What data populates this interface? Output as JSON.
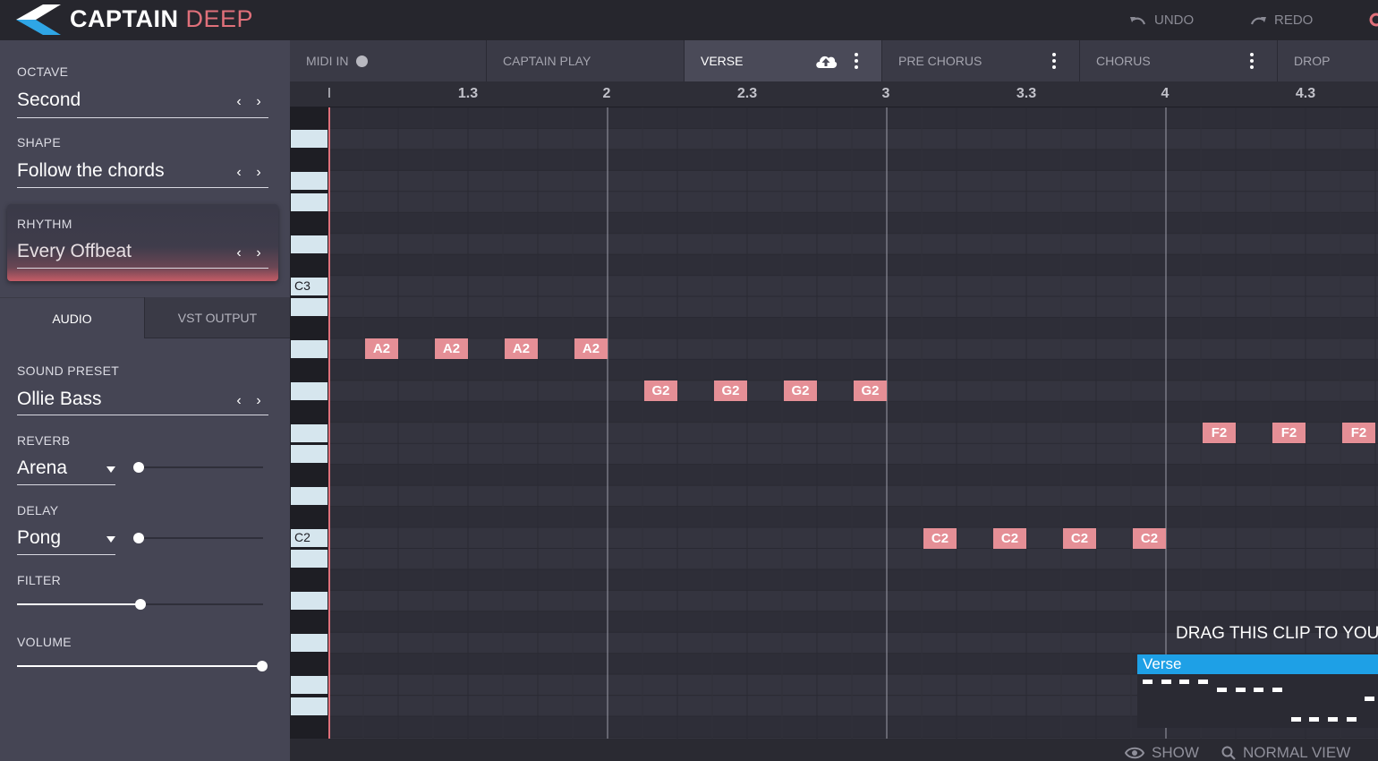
{
  "brand": {
    "first": "CAPTAIN",
    "second": "DEEP"
  },
  "topbar": {
    "undo": "UNDO",
    "redo": "REDO"
  },
  "controls": {
    "octave": {
      "label": "OCTAVE",
      "value": "Second"
    },
    "shape": {
      "label": "SHAPE",
      "value": "Follow the chords"
    },
    "rhythm": {
      "label": "RHYTHM",
      "value": "Every Offbeat"
    }
  },
  "tabs": {
    "audio": "AUDIO",
    "vst": "VST OUTPUT"
  },
  "audio": {
    "sound_preset": {
      "label": "SOUND PRESET",
      "value": "Ollie Bass"
    },
    "reverb": {
      "label": "REVERB",
      "value": "Arena",
      "amount": 0
    },
    "delay": {
      "label": "DELAY",
      "value": "Pong",
      "amount": 0
    },
    "filter": {
      "label": "FILTER",
      "amount": 0.5
    },
    "volume": {
      "label": "VOLUME",
      "amount": 1.0
    }
  },
  "sections": [
    {
      "label": "MIDI IN"
    },
    {
      "label": "CAPTAIN PLAY"
    },
    {
      "label": "VERSE",
      "active": true
    },
    {
      "label": "PRE CHORUS"
    },
    {
      "label": "CHORUS"
    },
    {
      "label": "DROP"
    }
  ],
  "ruler": {
    "start_tick": "I",
    "labels": [
      "1.3",
      "2",
      "2.3",
      "3",
      "3.3",
      "4",
      "4.3"
    ]
  },
  "piano": {
    "c3": "C3",
    "c2": "C2"
  },
  "notes": [
    {
      "pitch": "A2",
      "beat": 1
    },
    {
      "pitch": "A2",
      "beat": 2
    },
    {
      "pitch": "A2",
      "beat": 3
    },
    {
      "pitch": "A2",
      "beat": 4
    },
    {
      "pitch": "G2",
      "beat": 5
    },
    {
      "pitch": "G2",
      "beat": 6
    },
    {
      "pitch": "G2",
      "beat": 7
    },
    {
      "pitch": "G2",
      "beat": 8
    },
    {
      "pitch": "C2",
      "beat": 9
    },
    {
      "pitch": "C2",
      "beat": 10
    },
    {
      "pitch": "C2",
      "beat": 11
    },
    {
      "pitch": "C2",
      "beat": 12
    },
    {
      "pitch": "F2",
      "beat": 13
    },
    {
      "pitch": "F2",
      "beat": 14
    },
    {
      "pitch": "F2",
      "beat": 15
    }
  ],
  "drag": {
    "hint": "DRAG THIS CLIP TO YOUR",
    "clip_title": "Verse"
  },
  "footer": {
    "show": "SHOW",
    "normal_view": "NORMAL VIEW"
  },
  "colors": {
    "accent": "#e0707a",
    "note": "#e58f96",
    "clip": "#1ea0e6",
    "key": "#d6e6ee"
  },
  "icons": [
    "logo-icon",
    "undo-icon",
    "redo-icon",
    "settings-icon",
    "chevron-left-icon",
    "chevron-right-icon",
    "caret-down-icon",
    "cloud-upload-icon",
    "kebab-menu-icon",
    "eye-icon",
    "search-icon"
  ]
}
